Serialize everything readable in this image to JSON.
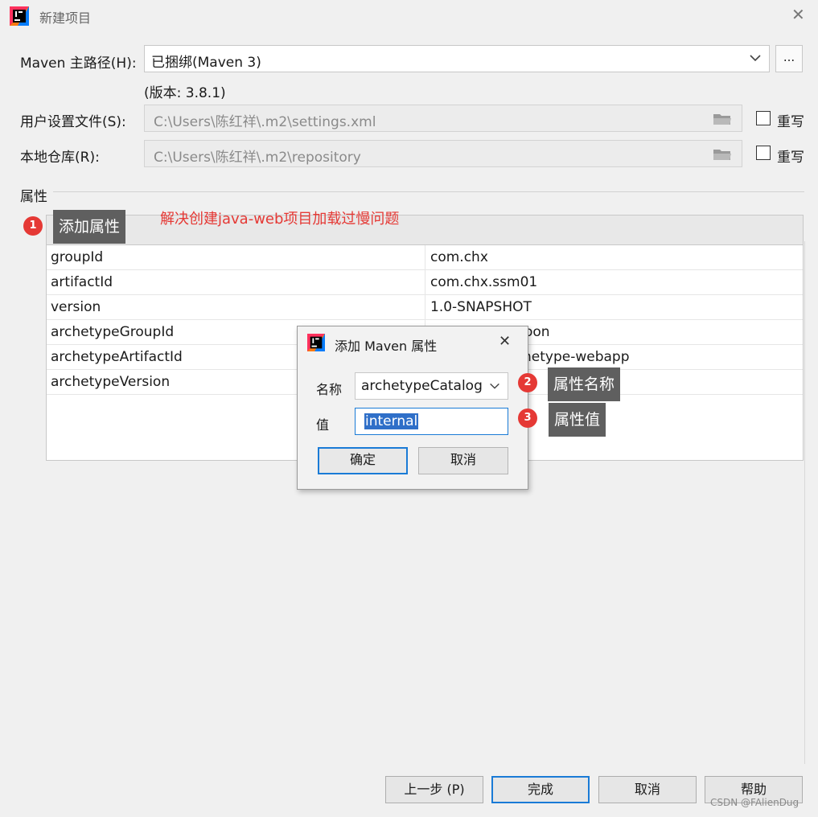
{
  "window": {
    "title": "新建项目"
  },
  "maven_home": {
    "label": "Maven 主路径(H):",
    "value": "已捆绑(Maven 3)",
    "browse_label": "...",
    "version_note": "(版本: 3.8.1)"
  },
  "user_settings": {
    "label": "用户设置文件(S):",
    "value": "C:\\Users\\陈红祥\\.m2\\settings.xml",
    "override_label": "重写",
    "override_checked": false
  },
  "local_repo": {
    "label": "本地仓库(R):",
    "value": "C:\\Users\\陈红祥\\.m2\\repository",
    "override_label": "重写",
    "override_checked": false
  },
  "properties": {
    "section_label": "属性",
    "add_callout": "添加属性",
    "annotation": "解决创建java-web项目加载过慢问题",
    "rows": [
      {
        "key": "groupId",
        "value": "com.chx"
      },
      {
        "key": "artifactId",
        "value": "com.chx.ssm01"
      },
      {
        "key": "version",
        "value": "1.0-SNAPSHOT"
      },
      {
        "key": "archetypeGroupId",
        "value": "oon"
      },
      {
        "key": "archetypeArtifactId",
        "value": "netype-webapp"
      },
      {
        "key": "archetypeVersion",
        "value": ""
      }
    ]
  },
  "dialog": {
    "title": "添加 Maven 属性",
    "name_label": "名称",
    "name_value": "archetypeCatalog",
    "value_label": "值",
    "value_value": "internal",
    "ok_label": "确定",
    "cancel_label": "取消",
    "name_callout": "属性名称",
    "value_callout": "属性值"
  },
  "badges": [
    "1",
    "2",
    "3"
  ],
  "footer": {
    "prev_label": "上一步 (P)",
    "finish_label": "完成",
    "cancel_label": "取消",
    "help_label": "帮助"
  },
  "watermark": "CSDN @FAlienDug",
  "colors": {
    "accent": "#1a7bd6",
    "annotation_red": "#e53935",
    "callout_bg": "#5f5f5f"
  }
}
